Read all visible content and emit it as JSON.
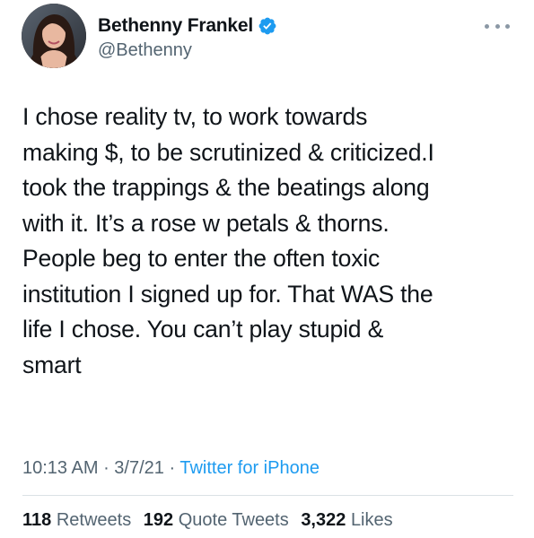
{
  "author": {
    "display_name": "Bethenny Frankel",
    "handle": "@Bethenny",
    "verified": true,
    "avatar_icon": "profile-photo",
    "verified_icon": "verified-badge-icon"
  },
  "more_icon": "more-dots-icon",
  "tweet": {
    "text": "I chose reality tv, to work towards\nmaking $, to be scrutinized & criticized.I\ntook the trappings & the beatings along\nwith it. It’s a rose w petals & thorns.\nPeople beg to enter the often toxic\ninstitution I signed up for. That WAS the\nlife I chose. You can’t play stupid &\nsmart"
  },
  "meta": {
    "time": "10:13 AM",
    "sep1": " · ",
    "date": "3/7/21",
    "sep2": " · ",
    "source": "Twitter for iPhone"
  },
  "stats": {
    "retweets_count": "118",
    "retweets_label": "Retweets",
    "quotes_count": "192",
    "quotes_label": "Quote Tweets",
    "likes_count": "3,322",
    "likes_label": "Likes"
  },
  "colors": {
    "text": "#0f1419",
    "secondary": "#536471",
    "link": "#1d9bf0",
    "verified": "#1d9bf0",
    "divider": "#dbe1e5"
  }
}
